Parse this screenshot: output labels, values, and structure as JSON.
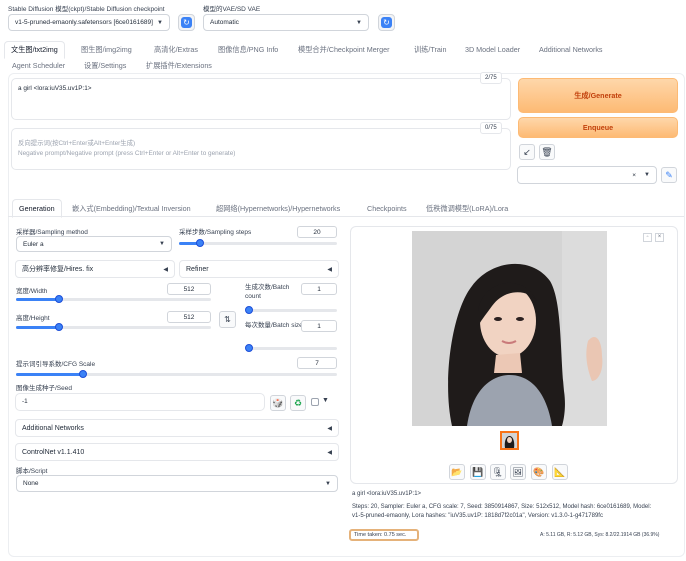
{
  "top": {
    "checkpoint_label": "Stable Diffusion 模型(ckpt)/Stable Diffusion checkpoint",
    "checkpoint_value": "v1-5-pruned-emaonly.safetensors [6ce0161689]",
    "vae_label": "模型的VAE/SD VAE",
    "vae_value": "Automatic"
  },
  "main_tabs": [
    "文生图/txt2img",
    "图生图/img2img",
    "高清化/Extras",
    "图像信息/PNG Info",
    "模型合并/Checkpoint Merger",
    "训练/Train",
    "3D Model Loader",
    "Additional Networks",
    "Agent Scheduler",
    "设置/Settings",
    "扩展插件/Extensions"
  ],
  "prompt": {
    "text": "a girl <lora:iuV35.uv1P:1>",
    "counter": "2/75",
    "neg_placeholder_1": "反向提示词(按Ctrl+Enter或Alt+Enter生成)",
    "neg_placeholder_2": "Negative prompt/Negative prompt (press Ctrl+Enter or Alt+Enter to generate)",
    "neg_counter": "0/75"
  },
  "actions": {
    "generate": "生成/Generate",
    "enqueue": "Enqueue"
  },
  "sub_tabs": [
    "Generation",
    "嵌入式(Embedding)/Textual Inversion",
    "超网络(Hypernetworks)/Hypernetworks",
    "Checkpoints",
    "低秩微调模型(LoRA)/Lora"
  ],
  "settings": {
    "sampler_label": "采样器/Sampling method",
    "sampler_value": "Euler a",
    "steps_label": "采样步数/Sampling steps",
    "steps_value": "20",
    "steps_fraction": 0.13,
    "hires_label": "高分辨率修复/Hires. fix",
    "refiner_label": "Refiner",
    "width_label": "宽度/Width",
    "width_value": "512",
    "width_fraction": 0.22,
    "height_label": "高度/Height",
    "height_value": "512",
    "height_fraction": 0.22,
    "batch_count_label": "生成次数/Batch count",
    "batch_count_value": "1",
    "batch_count_fraction": 0.02,
    "batch_size_label": "每次数量/Batch size",
    "batch_size_value": "1",
    "batch_size_fraction": 0.02,
    "cfg_label": "提示词引导系数/CFG Scale",
    "cfg_value": "7",
    "cfg_fraction": 0.21,
    "seed_label": "图像生成种子/Seed",
    "seed_value": "-1",
    "additional_networks": "Additional Networks",
    "controlnet": "ControlNet v1.1.410",
    "script_label": "脚本/Script",
    "script_value": "None"
  },
  "output": {
    "caption_line1": "a girl <lora:iuV35.uv1P:1>",
    "caption_line2": "Steps: 20, Sampler: Euler a, CFG scale: 7, Seed: 3850914867, Size: 512x512, Model hash: 6ce0161689, Model:",
    "caption_line3": "v1-5-pruned-emaonly, Lora hashes: \"iuV35.uv1P: 1818d7f2c01a\", Version: v1.3.0-1-g471789fc",
    "time_taken": "Time taken: 0.75 sec.",
    "vram": "A: 5.11 GB, R: 5.12 GB, Sys: 8.2/22.1914 GB (36.9%)"
  },
  "colors": {
    "accent": "#3b82f6",
    "generate_orange": "#fdba74",
    "highlight_box": "#e5b27a"
  },
  "icons": [
    "refresh-icon",
    "arrow-icon",
    "trash-icon",
    "clear-icon",
    "pencil-icon",
    "swap-icon",
    "dice-icon",
    "recycle-icon",
    "folder-icon",
    "save-icon",
    "zip-icon",
    "image-icon",
    "palette-icon",
    "ruler-icon"
  ]
}
